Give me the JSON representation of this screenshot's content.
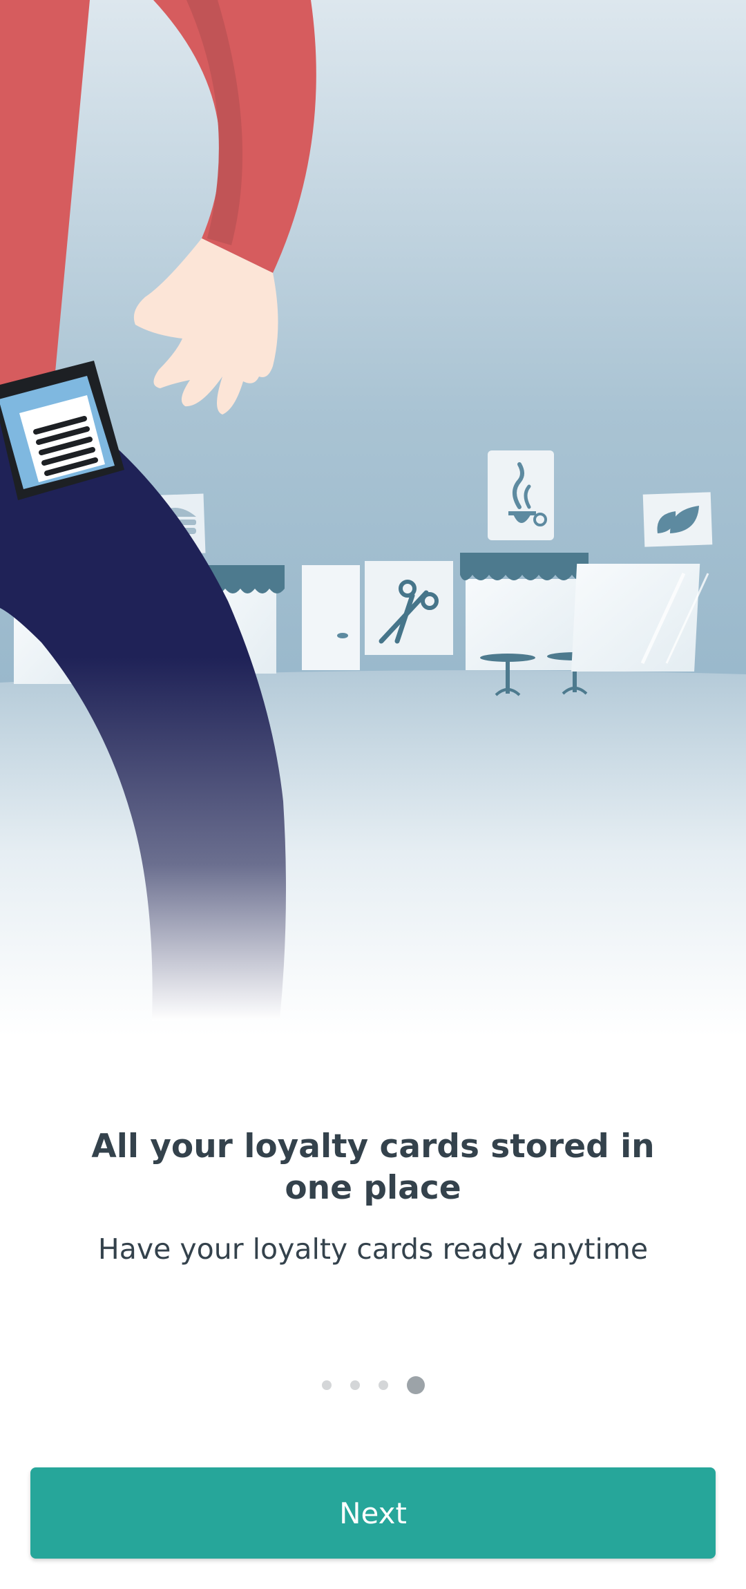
{
  "onboarding": {
    "title": "All your loyalty cards stored in one place",
    "subtitle": "Have your loyalty cards ready anytime",
    "pager": {
      "total": 4,
      "current": 4
    },
    "next_label": "Next"
  },
  "illustration": {
    "icons": [
      "burger-icon",
      "door-icon",
      "scissors-icon",
      "coffee-cup-icon",
      "leaf-icon",
      "barcode-icon"
    ]
  },
  "colors": {
    "accent": "#26a69a",
    "title_text": "#34424c",
    "dot_active": "#9ca3a8",
    "dot_inactive": "#d4d6d8"
  }
}
